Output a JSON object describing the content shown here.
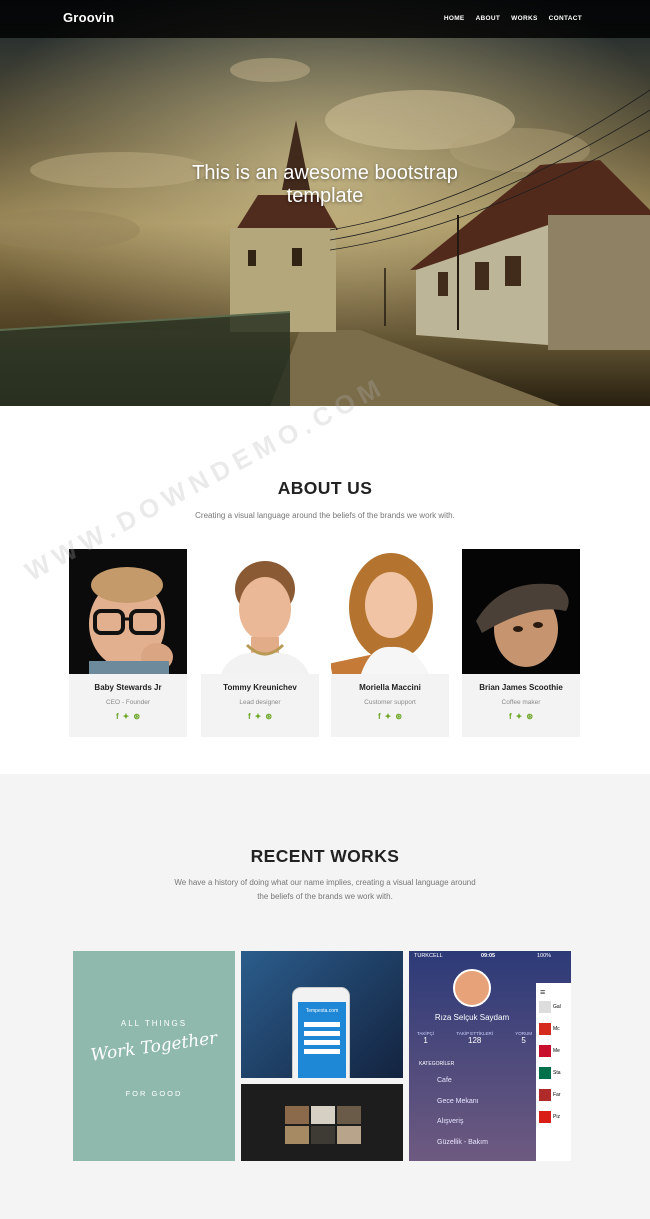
{
  "nav": {
    "brand": "Groovin",
    "items": [
      "HOME",
      "ABOUT",
      "WORKS",
      "CONTACT"
    ]
  },
  "hero": {
    "title_line1": "This is an awesome bootstrap",
    "title_line2": "template"
  },
  "about": {
    "title": "ABOUT US",
    "subtitle": "Creating a visual language around the beliefs of the brands we work with.",
    "team": [
      {
        "name": "Baby Stewards Jr",
        "role": "CEO - Founder"
      },
      {
        "name": "Tommy Kreunichev",
        "role": "Lead designer"
      },
      {
        "name": "Moriella Maccini",
        "role": "Customer support"
      },
      {
        "name": "Brian James Scoothie",
        "role": "Coffee maker"
      }
    ],
    "social_icons": [
      "facebook-icon",
      "twitter-icon",
      "dribbble-icon"
    ]
  },
  "works": {
    "title": "RECENT WORKS",
    "subtitle_line1": "We have a history of doing what our name implies, creating a visual language around",
    "subtitle_line2": "the beliefs of the brands we work with.",
    "poster": {
      "line1": "ALL THINGS",
      "line2": "Work Together",
      "line3": "FOR GOOD"
    },
    "phone_site": "Tempesta.com",
    "app": {
      "carrier": "TURKCELL",
      "time": "09:05",
      "battery": "100%",
      "user": "Rıza Selçuk Saydam",
      "stats": [
        {
          "label": "TAKİPÇİ",
          "value": "1"
        },
        {
          "label": "TAKİP ETTİKLERİ",
          "value": "128"
        },
        {
          "label": "YORUM",
          "value": "5"
        }
      ],
      "categories_label": "KATEGORİLER",
      "categories": [
        "Cafe",
        "Gece Mekanı",
        "Alışveriş",
        "Güzellik - Bakım"
      ],
      "side_items": [
        "Gal",
        "Mc",
        "Me",
        "Sta",
        "Far",
        "Piz"
      ]
    }
  },
  "watermark": "WWW.DOWNDEMO.COM",
  "colors": {
    "accent_green": "#6aa623",
    "works_bg": "#f4f4f4",
    "poster_bg": "#8fb9ad",
    "app_bg": "#27306a"
  }
}
